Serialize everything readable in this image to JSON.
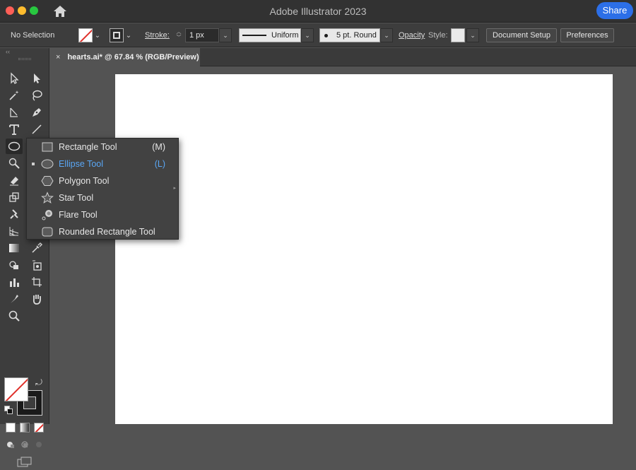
{
  "window": {
    "app_title": "Adobe Illustrator 2023",
    "share_label": "Share"
  },
  "control_bar": {
    "selection_status": "No Selection",
    "stroke_label": "Stroke:",
    "stroke_weight": "1 px",
    "variable_width_profile": "Uniform",
    "brush_definition": "5 pt. Round",
    "opacity_label": "Opacity",
    "style_label": "Style:",
    "document_setup_label": "Document Setup",
    "preferences_label": "Preferences"
  },
  "document_tab": {
    "close_glyph": "×",
    "title": "hearts.ai* @ 67.84 % (RGB/Preview)"
  },
  "toolbar": {
    "tools": [
      "selection-tool",
      "direct-selection-tool",
      "magic-wand-tool",
      "lasso-tool",
      "pen-tool",
      "curvature-tool",
      "type-tool",
      "line-segment-tool",
      "ellipse-tool",
      "paintbrush-tool",
      "shaper-tool",
      "eraser-tool",
      "rotate-tool",
      "scale-tool",
      "puppet-warp-tool",
      "free-transform-tool",
      "shape-builder-tool",
      "perspective-grid-tool",
      "gradient-tool",
      "eyedropper-tool",
      "blend-tool",
      "symbol-sprayer-tool",
      "column-graph-tool",
      "artboard-tool",
      "slice-tool",
      "hand-tool",
      "zoom-tool"
    ]
  },
  "shape_flyout": {
    "items": [
      {
        "label": "Rectangle Tool",
        "shortcut": "(M)",
        "icon": "rectangle-icon",
        "selected": false
      },
      {
        "label": "Ellipse Tool",
        "shortcut": "(L)",
        "icon": "ellipse-icon",
        "selected": true
      },
      {
        "label": "Polygon Tool",
        "shortcut": "",
        "icon": "polygon-icon",
        "selected": false
      },
      {
        "label": "Star Tool",
        "shortcut": "",
        "icon": "star-icon",
        "selected": false
      },
      {
        "label": "Flare Tool",
        "shortcut": "",
        "icon": "flare-icon",
        "selected": false
      },
      {
        "label": "Rounded Rectangle Tool",
        "shortcut": "",
        "icon": "rounded-rectangle-icon",
        "selected": false
      }
    ]
  },
  "colors": {
    "accent": "#2c6fe8",
    "selected_menu_text": "#5aa7f5",
    "none_slash": "#e0302a"
  }
}
